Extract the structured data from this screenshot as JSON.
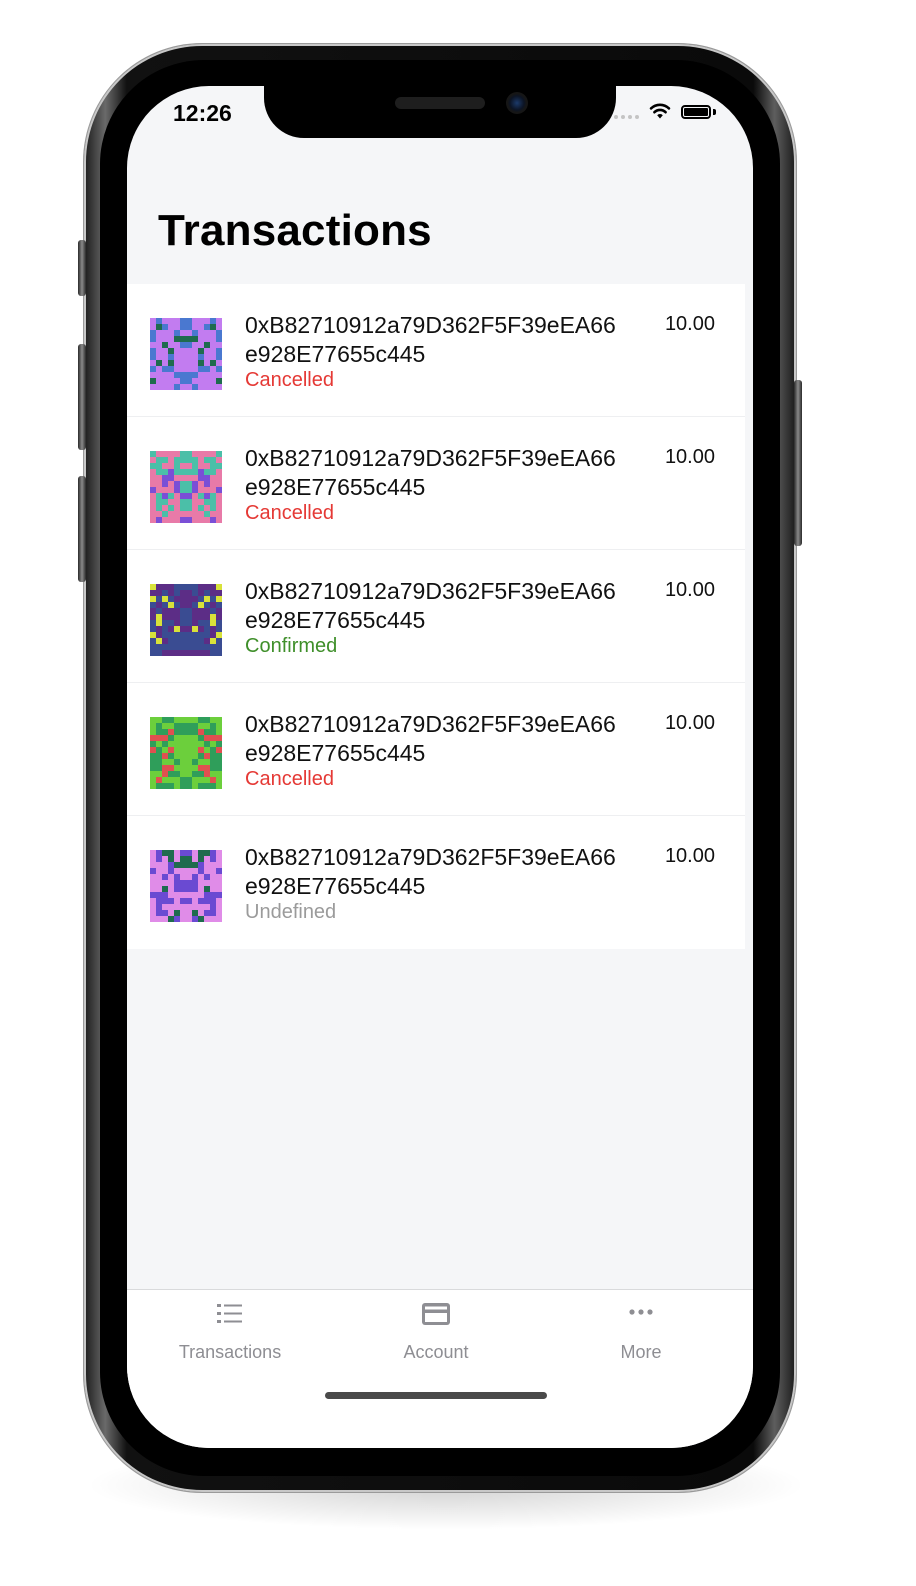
{
  "status_bar": {
    "time": "12:26"
  },
  "page": {
    "title": "Transactions"
  },
  "transactions": [
    {
      "address": "0xB82710912a79D362F5F39eEA66e928E77655c445",
      "status": "Cancelled",
      "amount": "10.00",
      "identicon_colors": [
        "#c27cf0",
        "#4a78d0",
        "#1f6b4e"
      ]
    },
    {
      "address": "0xB82710912a79D362F5F39eEA66e928E77655c445",
      "status": "Cancelled",
      "amount": "10.00",
      "identicon_colors": [
        "#e87aa8",
        "#4bbfa8",
        "#7a4fd6"
      ]
    },
    {
      "address": "0xB82710912a79D362F5F39eEA66e928E77655c445",
      "status": "Confirmed",
      "amount": "10.00",
      "identicon_colors": [
        "#3a4c92",
        "#5c2d86",
        "#d8e23a"
      ]
    },
    {
      "address": "0xB82710912a79D362F5F39eEA66e928E77655c445",
      "status": "Cancelled",
      "amount": "10.00",
      "identicon_colors": [
        "#6ccf3c",
        "#2f9e5a",
        "#e05050"
      ]
    },
    {
      "address": "0xB82710912a79D362F5F39eEA66e928E77655c445",
      "status": "Undefined",
      "amount": "10.00",
      "identicon_colors": [
        "#e08ce8",
        "#6a4ad2",
        "#1f6b4e"
      ]
    }
  ],
  "status_colors": {
    "Cancelled": "#e53935",
    "Confirmed": "#3f8f2a",
    "Undefined": "#9b9b9b"
  },
  "tab_bar": {
    "tabs": [
      {
        "label": "Transactions",
        "icon": "list-icon"
      },
      {
        "label": "Account",
        "icon": "card-icon"
      },
      {
        "label": "More",
        "icon": "more-icon"
      }
    ]
  }
}
